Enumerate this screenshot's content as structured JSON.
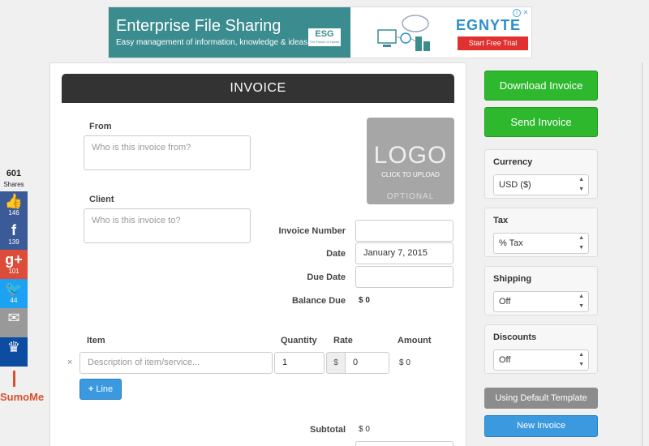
{
  "ad": {
    "title": "Enterprise File Sharing",
    "subtitle": "Easy management of information, knowledge & ideas",
    "badge": "ESG",
    "badge_sub": "The Father of Hybrid",
    "brand": "EGNYTE",
    "cta": "Start Free Trial",
    "close": "✕",
    "info": "i",
    "color": "#3b8c8f"
  },
  "share": {
    "count": "601",
    "label": "Shares",
    "buttons": [
      {
        "name": "facebook-like",
        "icon": "thumbs-up-icon",
        "glyph": "👍",
        "count": "146",
        "color": "#3b5b98"
      },
      {
        "name": "facebook",
        "icon": "facebook-icon",
        "glyph": "f",
        "count": "139",
        "color": "#3b5b98"
      },
      {
        "name": "google-plus",
        "icon": "google-plus-icon",
        "glyph": "g+",
        "count": "101",
        "color": "#dd4b39"
      },
      {
        "name": "twitter",
        "icon": "twitter-icon",
        "glyph": "🐦",
        "count": "44",
        "color": "#1da1f2"
      },
      {
        "name": "email",
        "icon": "email-icon",
        "glyph": "✉",
        "count": "",
        "color": "#999999"
      },
      {
        "name": "sumome-crown",
        "icon": "crown-icon",
        "glyph": "♛",
        "count": "",
        "color": "#0c4da2"
      }
    ],
    "brand": "SumoMe"
  },
  "invoice": {
    "title": "INVOICE",
    "from_label": "From",
    "from_placeholder": "Who is this invoice from?",
    "client_label": "Client",
    "client_placeholder": "Who is this invoice to?",
    "logo": {
      "big": "LOGO",
      "small": "CLICK TO UPLOAD",
      "optional": "OPTIONAL"
    },
    "invoice_number_label": "Invoice Number",
    "invoice_number_value": "",
    "date_label": "Date",
    "date_value": "January 7, 2015",
    "due_date_label": "Due Date",
    "due_date_value": "",
    "balance_due_label": "Balance Due",
    "balance_due_value": "$ 0",
    "items": {
      "headers": {
        "item": "Item",
        "quantity": "Quantity",
        "rate": "Rate",
        "amount": "Amount"
      },
      "rows": [
        {
          "remove": "×",
          "description_placeholder": "Description of item/service...",
          "quantity": "1",
          "currency": "$",
          "rate": "0",
          "amount": "$ 0"
        }
      ],
      "add_line_label": "Line",
      "add_line_glyph": "+"
    },
    "subtotal_label": "Subtotal",
    "subtotal_value": "$ 0"
  },
  "sidebar": {
    "download_label": "Download Invoice",
    "send_label": "Send Invoice",
    "currency": {
      "title": "Currency",
      "selected": "USD ($)"
    },
    "tax": {
      "title": "Tax",
      "selected": "% Tax"
    },
    "shipping": {
      "title": "Shipping",
      "selected": "Off"
    },
    "discounts": {
      "title": "Discounts",
      "selected": "Off"
    },
    "template_label": "Using Default Template",
    "new_invoice_label": "New Invoice",
    "accent_green": "#2eb82e",
    "accent_blue": "#3b99e0"
  }
}
